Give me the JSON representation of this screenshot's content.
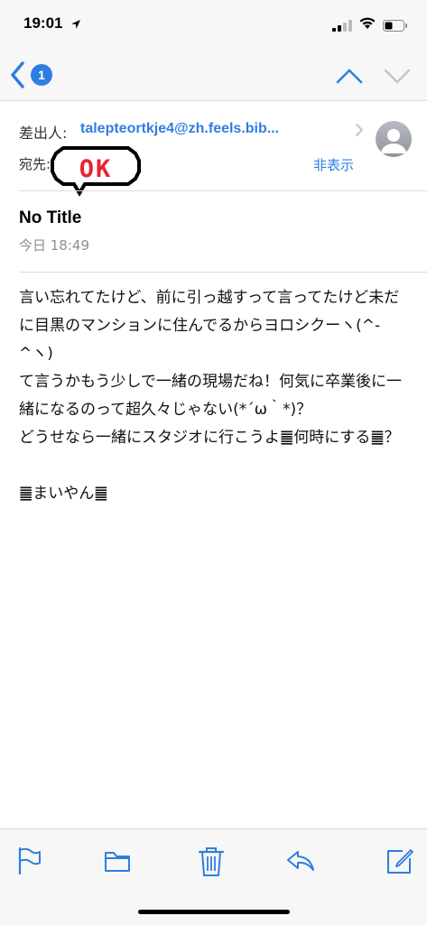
{
  "status": {
    "time": "19:01"
  },
  "nav": {
    "badge": "1"
  },
  "header": {
    "from_label": "差出人:",
    "from_address": "talepteortkje4@zh.feels.bib...",
    "to_label": "宛先:",
    "hide_label": "非表示",
    "sticker_text": "OK",
    "subject": "No Title",
    "date": "今日 18:49"
  },
  "body": {
    "lines": [
      "言い忘れてたけど、前に引っ越すって言ってたけど未だに目黒のマンションに住んでるからヨロシクーヽ(^-^ヽ)",
      "て言うかもう少しで一緒の現場だね！何気に卒業後に一緒になるのって超久々じゃない(*´ω｀*)？",
      "どうせなら一緒にスタジオに行こうよ䷀何時にする䷀？",
      "",
      "䷀まいやん䷀"
    ]
  },
  "toolbar": {
    "icons": [
      "flag-icon",
      "folder-icon",
      "trash-icon",
      "reply-icon",
      "compose-icon"
    ]
  },
  "colors": {
    "accent": "#2f7de1",
    "sticker_red": "#e8242f"
  }
}
